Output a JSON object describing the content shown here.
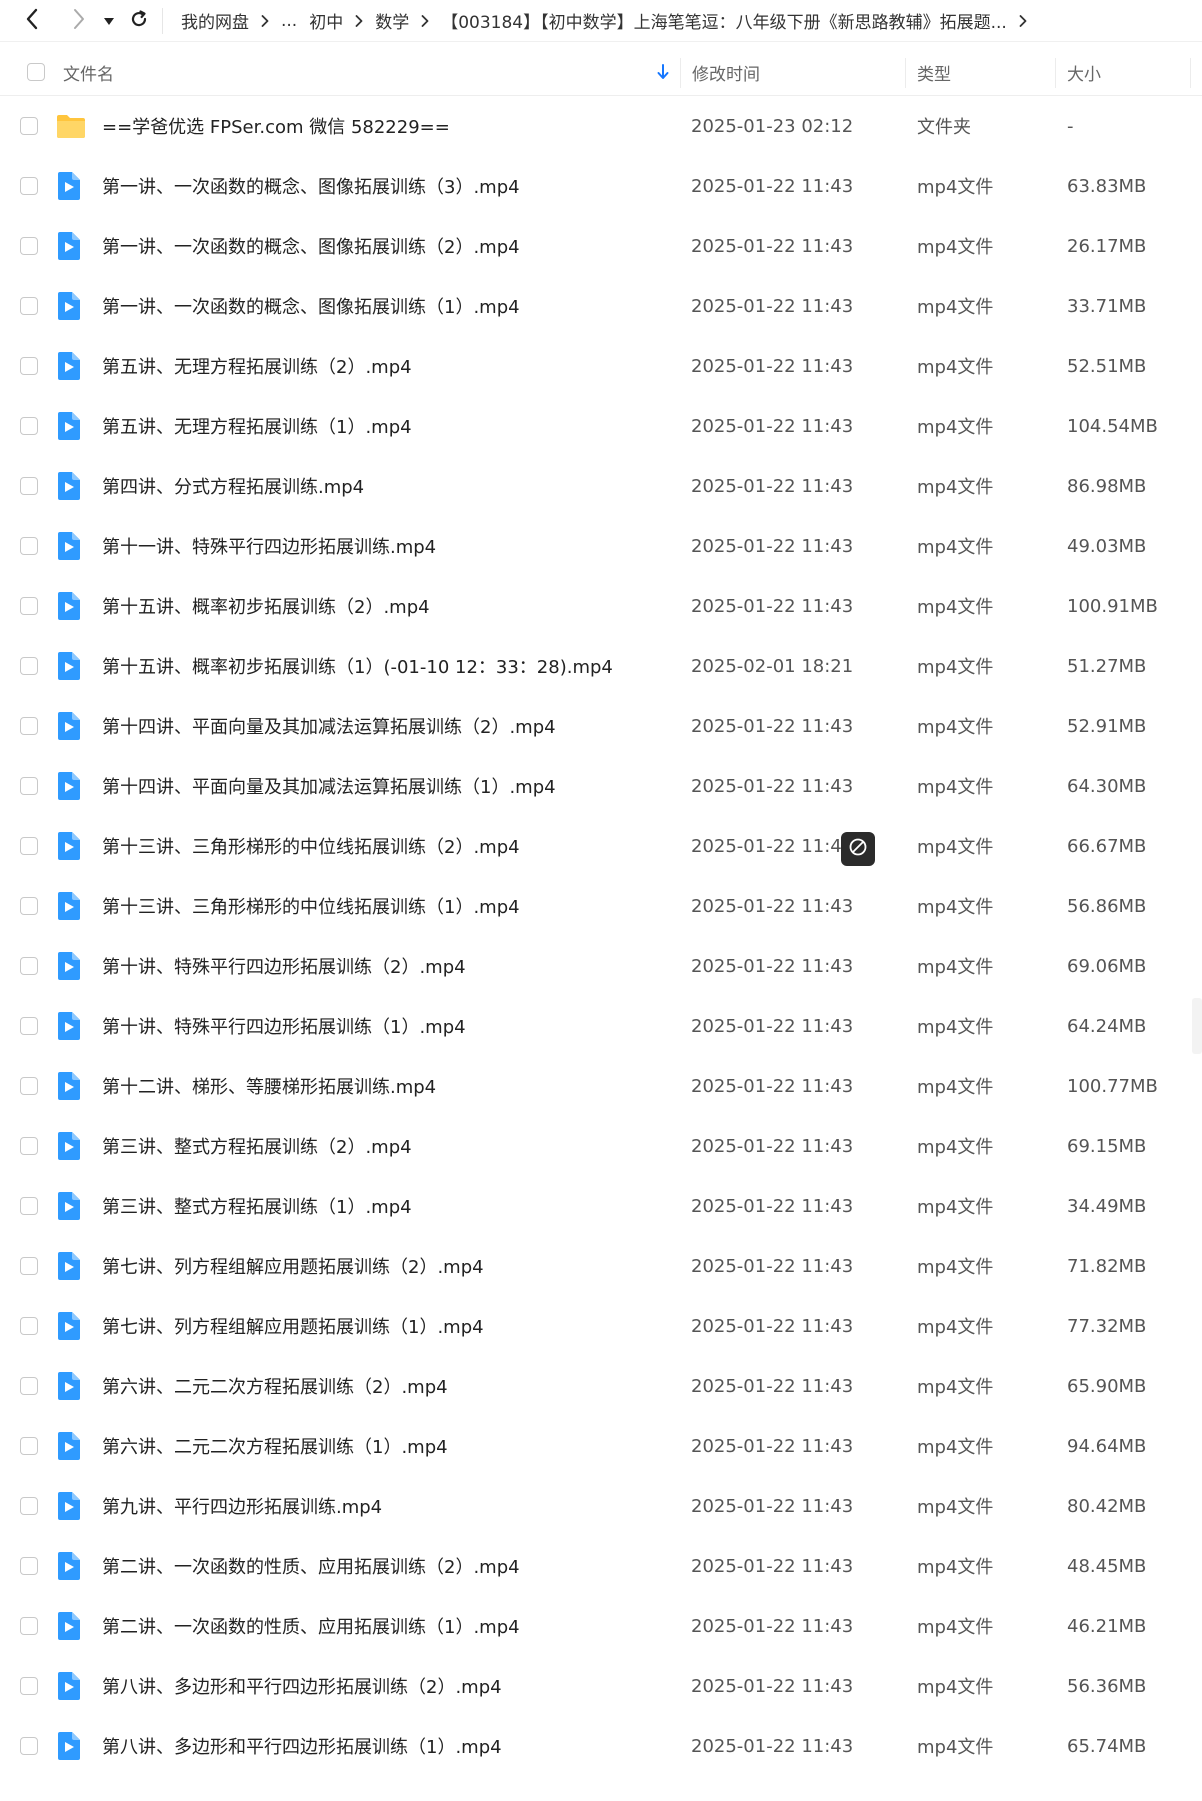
{
  "nav": {
    "back_icon": "chevron-left-icon",
    "forward_icon": "chevron-right-icon",
    "dropdown_icon": "caret-down-icon",
    "refresh_icon": "refresh-icon"
  },
  "breadcrumb": [
    "我的网盘",
    "...",
    "初中",
    "数学",
    "【003184】【初中数学】上海笔笔逗：八年级下册《新思路教辅》拓展题..."
  ],
  "columns": {
    "name": "文件名",
    "modified": "修改时间",
    "type": "类型",
    "size": "大小"
  },
  "colors": {
    "accent": "#1677ff",
    "folder": "#ffc53d",
    "video": "#2f9bff"
  },
  "files": [
    {
      "name": "==学爸优选 FPSer.com 微信 582229==",
      "time": "2025-01-23 02:12",
      "type": "文件夹",
      "size": "-",
      "icon": "folder-icon"
    },
    {
      "name": "第一讲、一次函数的概念、图像拓展训练（3）.mp4",
      "time": "2025-01-22 11:43",
      "type": "mp4文件",
      "size": "63.83MB",
      "icon": "video-file-icon"
    },
    {
      "name": "第一讲、一次函数的概念、图像拓展训练（2）.mp4",
      "time": "2025-01-22 11:43",
      "type": "mp4文件",
      "size": "26.17MB",
      "icon": "video-file-icon"
    },
    {
      "name": "第一讲、一次函数的概念、图像拓展训练（1）.mp4",
      "time": "2025-01-22 11:43",
      "type": "mp4文件",
      "size": "33.71MB",
      "icon": "video-file-icon"
    },
    {
      "name": "第五讲、无理方程拓展训练（2）.mp4",
      "time": "2025-01-22 11:43",
      "type": "mp4文件",
      "size": "52.51MB",
      "icon": "video-file-icon"
    },
    {
      "name": "第五讲、无理方程拓展训练（1）.mp4",
      "time": "2025-01-22 11:43",
      "type": "mp4文件",
      "size": "104.54MB",
      "icon": "video-file-icon"
    },
    {
      "name": "第四讲、分式方程拓展训练.mp4",
      "time": "2025-01-22 11:43",
      "type": "mp4文件",
      "size": "86.98MB",
      "icon": "video-file-icon"
    },
    {
      "name": "第十一讲、特殊平行四边形拓展训练.mp4",
      "time": "2025-01-22 11:43",
      "type": "mp4文件",
      "size": "49.03MB",
      "icon": "video-file-icon"
    },
    {
      "name": "第十五讲、概率初步拓展训练（2）.mp4",
      "time": "2025-01-22 11:43",
      "type": "mp4文件",
      "size": "100.91MB",
      "icon": "video-file-icon"
    },
    {
      "name": "第十五讲、概率初步拓展训练（1）(-01-10 12：33：28).mp4",
      "time": "2025-02-01 18:21",
      "type": "mp4文件",
      "size": "51.27MB",
      "icon": "video-file-icon"
    },
    {
      "name": "第十四讲、平面向量及其加减法运算拓展训练（2）.mp4",
      "time": "2025-01-22 11:43",
      "type": "mp4文件",
      "size": "52.91MB",
      "icon": "video-file-icon"
    },
    {
      "name": "第十四讲、平面向量及其加减法运算拓展训练（1）.mp4",
      "time": "2025-01-22 11:43",
      "type": "mp4文件",
      "size": "64.30MB",
      "icon": "video-file-icon"
    },
    {
      "name": "第十三讲、三角形梯形的中位线拓展训练（2）.mp4",
      "time": "2025-01-22 11:4",
      "type": "mp4文件",
      "size": "66.67MB",
      "icon": "video-file-icon"
    },
    {
      "name": "第十三讲、三角形梯形的中位线拓展训练（1）.mp4",
      "time": "2025-01-22 11:43",
      "type": "mp4文件",
      "size": "56.86MB",
      "icon": "video-file-icon"
    },
    {
      "name": "第十讲、特殊平行四边形拓展训练（2）.mp4",
      "time": "2025-01-22 11:43",
      "type": "mp4文件",
      "size": "69.06MB",
      "icon": "video-file-icon"
    },
    {
      "name": "第十讲、特殊平行四边形拓展训练（1）.mp4",
      "time": "2025-01-22 11:43",
      "type": "mp4文件",
      "size": "64.24MB",
      "icon": "video-file-icon"
    },
    {
      "name": "第十二讲、梯形、等腰梯形拓展训练.mp4",
      "time": "2025-01-22 11:43",
      "type": "mp4文件",
      "size": "100.77MB",
      "icon": "video-file-icon"
    },
    {
      "name": "第三讲、整式方程拓展训练（2）.mp4",
      "time": "2025-01-22 11:43",
      "type": "mp4文件",
      "size": "69.15MB",
      "icon": "video-file-icon"
    },
    {
      "name": "第三讲、整式方程拓展训练（1）.mp4",
      "time": "2025-01-22 11:43",
      "type": "mp4文件",
      "size": "34.49MB",
      "icon": "video-file-icon"
    },
    {
      "name": "第七讲、列方程组解应用题拓展训练（2）.mp4",
      "time": "2025-01-22 11:43",
      "type": "mp4文件",
      "size": "71.82MB",
      "icon": "video-file-icon"
    },
    {
      "name": "第七讲、列方程组解应用题拓展训练（1）.mp4",
      "time": "2025-01-22 11:43",
      "type": "mp4文件",
      "size": "77.32MB",
      "icon": "video-file-icon"
    },
    {
      "name": "第六讲、二元二次方程拓展训练（2）.mp4",
      "time": "2025-01-22 11:43",
      "type": "mp4文件",
      "size": "65.90MB",
      "icon": "video-file-icon"
    },
    {
      "name": "第六讲、二元二次方程拓展训练（1）.mp4",
      "time": "2025-01-22 11:43",
      "type": "mp4文件",
      "size": "94.64MB",
      "icon": "video-file-icon"
    },
    {
      "name": "第九讲、平行四边形拓展训练.mp4",
      "time": "2025-01-22 11:43",
      "type": "mp4文件",
      "size": "80.42MB",
      "icon": "video-file-icon"
    },
    {
      "name": "第二讲、一次函数的性质、应用拓展训练（2）.mp4",
      "time": "2025-01-22 11:43",
      "type": "mp4文件",
      "size": "48.45MB",
      "icon": "video-file-icon"
    },
    {
      "name": "第二讲、一次函数的性质、应用拓展训练（1）.mp4",
      "time": "2025-01-22 11:43",
      "type": "mp4文件",
      "size": "46.21MB",
      "icon": "video-file-icon"
    },
    {
      "name": "第八讲、多边形和平行四边形拓展训练（2）.mp4",
      "time": "2025-01-22 11:43",
      "type": "mp4文件",
      "size": "56.36MB",
      "icon": "video-file-icon"
    },
    {
      "name": "第八讲、多边形和平行四边形拓展训练（1）.mp4",
      "time": "2025-01-22 11:43",
      "type": "mp4文件",
      "size": "65.74MB",
      "icon": "video-file-icon"
    }
  ]
}
